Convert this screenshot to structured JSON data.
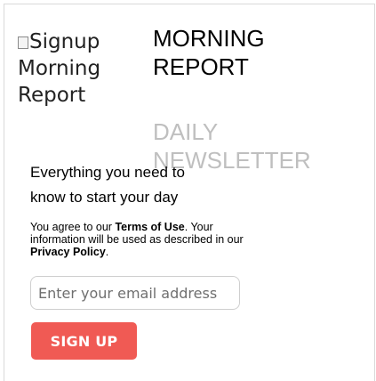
{
  "logo": {
    "alt_text": "Signup Morning Report"
  },
  "header": {
    "title_line1": "MORNING",
    "title_line2": "REPORT",
    "subtitle_line1": "DAILY",
    "subtitle_line2": "NEWSLETTER"
  },
  "tagline": {
    "line1": "Everything you need to",
    "line2": "know to start your day"
  },
  "legal": {
    "prefix": "You agree to our ",
    "terms_link": "Terms of Use",
    "middle": ". Your information will be used as described in our ",
    "privacy_link": "Privacy Policy",
    "suffix": "."
  },
  "form": {
    "email_placeholder": "Enter your email address",
    "email_value": "",
    "submit_label": "SIGN UP"
  },
  "colors": {
    "button": "#f05a54",
    "subtitle": "#bfbfbf",
    "input_border": "#cfcfcf"
  }
}
